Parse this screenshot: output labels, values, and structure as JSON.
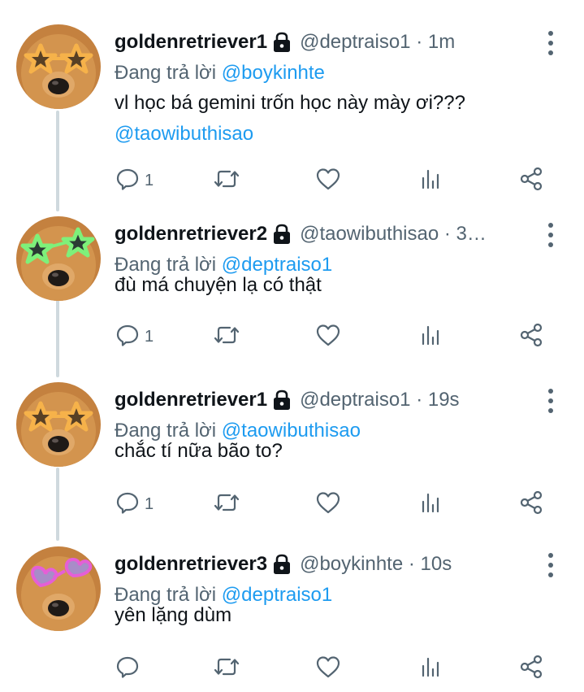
{
  "reply_prefix": "Đang trả lời",
  "tweets": [
    {
      "name": "goldenretriever1",
      "handle_meta": "@deptraiso1 · 1m",
      "reply_to": "@boykinhte",
      "text": "vl học bá gemini trốn học này mày ơi???",
      "text_mention": "@taowibuthisao",
      "reply_count": "1",
      "glasses": "star-orange"
    },
    {
      "name": "goldenretriever2",
      "handle_meta": "@taowibuthisao · 3…",
      "reply_to": "@deptraiso1",
      "text": "đù má chuyện lạ có thật",
      "text_mention": "",
      "reply_count": "1",
      "glasses": "star-green"
    },
    {
      "name": "goldenretriever1",
      "handle_meta": "@deptraiso1 · 19s",
      "reply_to": "@taowibuthisao",
      "text": "chắc tí nữa bão to?",
      "text_mention": "",
      "reply_count": "1",
      "glasses": "star-orange"
    },
    {
      "name": "goldenretriever3",
      "handle_meta": "@boykinhte · 10s",
      "reply_to": "@deptraiso1",
      "text": "yên lặng dùm",
      "text_mention": "",
      "reply_count": "",
      "glasses": "heart-pink"
    }
  ],
  "icons": {
    "reply": "comment-icon",
    "retweet": "retweet-icon",
    "like": "heart-icon",
    "views": "analytics-icon",
    "share": "share-icon",
    "more": "more-options-icon",
    "lock": "lock-icon"
  },
  "colors": {
    "link": "#1d9bf0",
    "secondary_text": "#536471",
    "thread_line": "#cfd9de"
  }
}
